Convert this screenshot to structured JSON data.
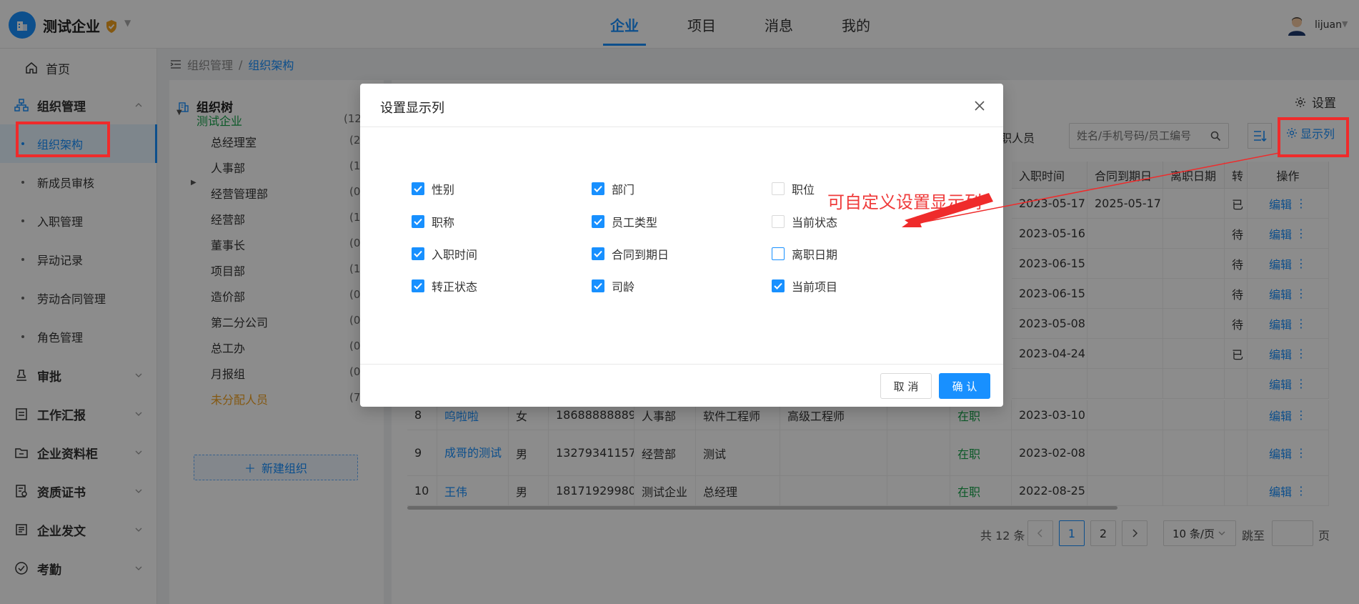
{
  "header": {
    "company_name": "测试企业",
    "nav": [
      "企业",
      "项目",
      "消息",
      "我的"
    ],
    "active_nav": "企业",
    "user_name": "lijuan"
  },
  "sidebar": {
    "home": "首页",
    "org_management": "组织管理",
    "sub_items": [
      "组织架构",
      "新成员审核",
      "入职管理",
      "异动记录",
      "劳动合同管理",
      "角色管理"
    ],
    "active_sub": "组织架构",
    "menus": [
      "审批",
      "工作汇报",
      "企业资料柜",
      "资质证书",
      "企业发文",
      "考勤"
    ]
  },
  "breadcrumb": {
    "parent": "组织管理",
    "separator": "/",
    "current": "组织架构"
  },
  "org_tree": {
    "title": "组织树",
    "root": {
      "name": "测试企业",
      "count": "(12"
    },
    "nodes": [
      {
        "name": "总经理室",
        "count": "(2"
      },
      {
        "name": "人事部",
        "count": "(1"
      },
      {
        "name": "经营管理部",
        "count": "(0"
      },
      {
        "name": "经营部",
        "count": "(1"
      },
      {
        "name": "董事长",
        "count": "(0"
      },
      {
        "name": "项目部",
        "count": "(1"
      },
      {
        "name": "造价部",
        "count": "(0"
      },
      {
        "name": "第二分公司",
        "count": "(0"
      },
      {
        "name": "总工办",
        "count": "(0"
      },
      {
        "name": "月报组",
        "count": "(0"
      }
    ],
    "unassigned": {
      "name": "未分配人员",
      "count": "(7)"
    },
    "new_button": "新建组织"
  },
  "main": {
    "settings_label": "设置",
    "staff_label": "职人员",
    "search_placeholder": "姓名/手机号码/员工编号",
    "show_columns_label": "显示列"
  },
  "table": {
    "headers": {
      "join_date": "入职时间",
      "contract_end": "合同到期日",
      "leave_date": "离职日期",
      "regular": "转",
      "action": "操作"
    },
    "top_rows": [
      {
        "join": "2023-05-17",
        "contract": "2025-05-17",
        "regular": "已",
        "action": "编辑"
      },
      {
        "join": "2023-05-16",
        "contract": "",
        "regular": "待",
        "action": "编辑"
      },
      {
        "join": "2023-06-15",
        "contract": "",
        "regular": "待",
        "action": "编辑"
      },
      {
        "join": "2023-06-15",
        "contract": "",
        "regular": "待",
        "action": "编辑"
      },
      {
        "join": "2023-05-08",
        "contract": "",
        "regular": "待",
        "action": "编辑"
      },
      {
        "join": "2023-04-24",
        "contract": "",
        "regular": "已",
        "action": "编辑"
      },
      {
        "join": "",
        "contract": "",
        "regular": "",
        "action": "编辑"
      }
    ],
    "bottom_rows": [
      {
        "no": "8",
        "name": "呜啦啦",
        "gender": "女",
        "phone": "18688888889",
        "dept": "人事部",
        "title": "软件工程师",
        "rank": "高级工程师",
        "status": "在职",
        "join": "2023-03-10",
        "action": "编辑"
      },
      {
        "no": "9",
        "name": "成哥的测试",
        "gender": "男",
        "phone": "13279341157",
        "dept": "经营部",
        "title": "测试",
        "rank": "",
        "status": "在职",
        "join": "2023-02-08",
        "action": "编辑"
      },
      {
        "no": "10",
        "name": "王伟",
        "gender": "男",
        "phone": "18171929980",
        "dept": "测试企业",
        "title": "总经理",
        "rank": "",
        "status": "在职",
        "join": "2022-08-25",
        "action": "编辑"
      }
    ]
  },
  "pagination": {
    "total": "共 12 条",
    "pages": [
      "1",
      "2"
    ],
    "current": "1",
    "page_size": "10 条/页",
    "jump_label": "跳至",
    "page_suffix": "页"
  },
  "modal": {
    "title": "设置显示列",
    "options": [
      {
        "label": "性别",
        "checked": true
      },
      {
        "label": "部门",
        "checked": true
      },
      {
        "label": "职位",
        "checked": false
      },
      {
        "label": "职称",
        "checked": true
      },
      {
        "label": "员工类型",
        "checked": true
      },
      {
        "label": "当前状态",
        "checked": false
      },
      {
        "label": "入职时间",
        "checked": true
      },
      {
        "label": "合同到期日",
        "checked": true
      },
      {
        "label": "离职日期",
        "checked": false
      },
      {
        "label": "转正状态",
        "checked": true
      },
      {
        "label": "司龄",
        "checked": true
      },
      {
        "label": "当前项目",
        "checked": true
      }
    ],
    "cancel": "取 消",
    "confirm": "确 认"
  },
  "annotation": {
    "text": "可自定义设置显示列",
    "color": "#ef2b2b"
  },
  "colors": {
    "primary": "#1890ff",
    "success": "#16a34a",
    "warning": "#f0a020"
  }
}
